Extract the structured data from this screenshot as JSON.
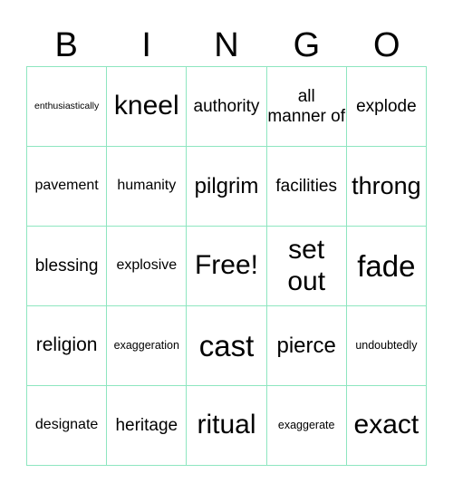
{
  "header": [
    "B",
    "I",
    "N",
    "G",
    "O"
  ],
  "cells": [
    {
      "text": "enthusiastically",
      "size": "s10"
    },
    {
      "text": "kneel",
      "size": "s28"
    },
    {
      "text": "authority",
      "size": "s19"
    },
    {
      "text": "all manner of",
      "size": "s19"
    },
    {
      "text": "explode",
      "size": "s19"
    },
    {
      "text": "pavement",
      "size": "s16"
    },
    {
      "text": "humanity",
      "size": "s16"
    },
    {
      "text": "pilgrim",
      "size": "s23"
    },
    {
      "text": "facilities",
      "size": "s19"
    },
    {
      "text": "throng",
      "size": "s26"
    },
    {
      "text": "blessing",
      "size": "s19"
    },
    {
      "text": "explosive",
      "size": "s16"
    },
    {
      "text": "Free!",
      "size": "s28"
    },
    {
      "text": "set out",
      "size": "s28"
    },
    {
      "text": "fade",
      "size": "s32"
    },
    {
      "text": "religion",
      "size": "s21"
    },
    {
      "text": "exaggeration",
      "size": "s12"
    },
    {
      "text": "cast",
      "size": "s32"
    },
    {
      "text": "pierce",
      "size": "s23"
    },
    {
      "text": "undoubtedly",
      "size": "s12"
    },
    {
      "text": "designate",
      "size": "s16"
    },
    {
      "text": "heritage",
      "size": "s19"
    },
    {
      "text": "ritual",
      "size": "s28"
    },
    {
      "text": "exaggerate",
      "size": "s12"
    },
    {
      "text": "exact",
      "size": "s28"
    }
  ]
}
